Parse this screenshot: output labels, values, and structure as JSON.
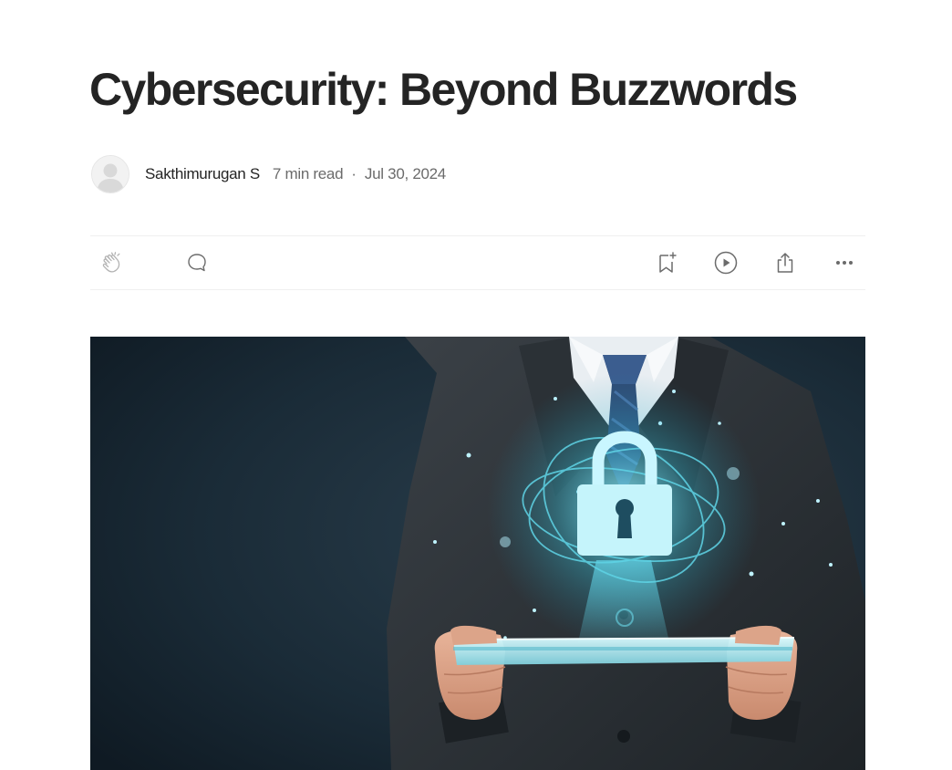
{
  "article": {
    "title": "Cybersecurity: Beyond Buzzwords",
    "author": "Sakthimurugan S",
    "read_time": "7 min read",
    "separator": "·",
    "date": "Jul 30, 2024"
  },
  "actions": {
    "icons": [
      "clap-icon",
      "comment-icon",
      "bookmark-add-icon",
      "play-icon",
      "share-icon",
      "more-icon"
    ]
  },
  "colors": {
    "text_primary": "#242424",
    "text_secondary": "#6b6b6b",
    "divider": "#f0f0f0",
    "hero_background": "#16232e",
    "lock_glow": "#7fe3f0"
  }
}
